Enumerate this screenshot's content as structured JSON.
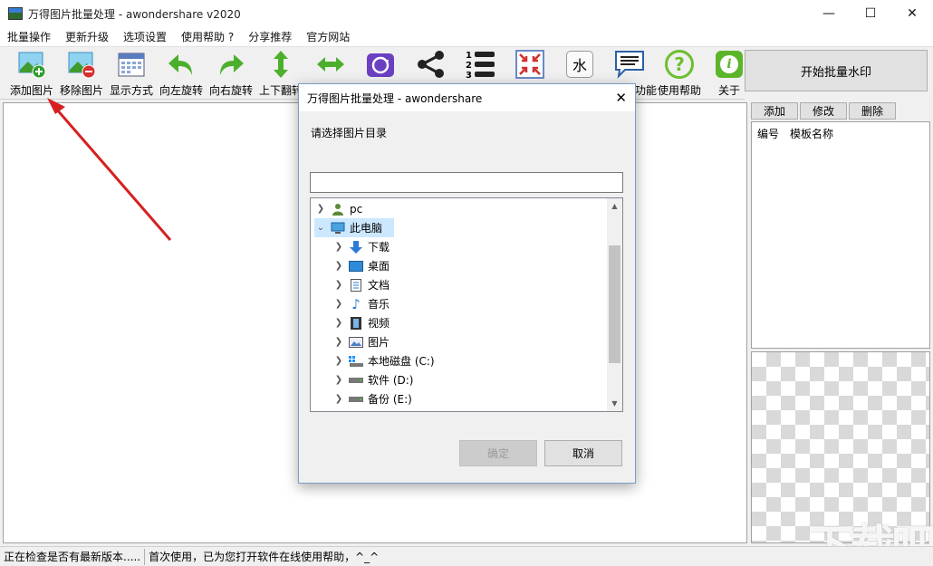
{
  "window": {
    "title": "万得图片批量处理 - awondershare v2020",
    "minimize": "—",
    "maximize": "☐",
    "close": "✕"
  },
  "menu": [
    "批量操作",
    "更新升级",
    "选项设置",
    "使用帮助 ?",
    "分享推荐",
    "官方网站"
  ],
  "toolbar": [
    {
      "label": "添加图片",
      "icon": "add-image-icon"
    },
    {
      "label": "移除图片",
      "icon": "remove-image-icon"
    },
    {
      "label": "显示方式",
      "icon": "display-mode-icon"
    },
    {
      "label": "向左旋转",
      "icon": "rotate-left-icon"
    },
    {
      "label": "向右旋转",
      "icon": "rotate-right-icon"
    },
    {
      "label": "上下翻转",
      "icon": "flip-vertical-icon"
    },
    {
      "label": "",
      "icon": "flip-horizontal-icon"
    },
    {
      "label": "",
      "icon": "camera-rotate-icon"
    },
    {
      "label": "",
      "icon": "share-icon"
    },
    {
      "label": "",
      "icon": "numbered-list-icon"
    },
    {
      "label": "",
      "icon": "resize-icon"
    },
    {
      "label": "",
      "icon": "watermark-icon",
      "glyph": "水"
    },
    {
      "label": "功能",
      "icon": "message-icon"
    },
    {
      "label": "使用帮助",
      "icon": "help-icon",
      "glyph": "?"
    },
    {
      "label": "关于",
      "icon": "info-icon",
      "glyph": "i"
    }
  ],
  "start_button": "开始批量水印",
  "template_panel": {
    "buttons": [
      "添加",
      "修改",
      "删除"
    ],
    "columns": [
      "编号",
      "模板名称"
    ]
  },
  "status": {
    "left": "正在检查是否有最新版本.....",
    "right": "首次使用，已为您打开软件在线使用帮助，^_^"
  },
  "dialog": {
    "title": "万得图片批量处理 - awondershare",
    "close": "✕",
    "prompt": "请选择图片目录",
    "input_value": "",
    "tree": [
      {
        "label": "pc",
        "level": 0,
        "expanded": false,
        "icon": "user-icon",
        "selected": false
      },
      {
        "label": "此电脑",
        "level": 0,
        "expanded": true,
        "icon": "computer-icon",
        "selected": true
      },
      {
        "label": "下载",
        "level": 1,
        "expanded": false,
        "icon": "download-icon",
        "selected": false
      },
      {
        "label": "桌面",
        "level": 1,
        "expanded": false,
        "icon": "desktop-icon",
        "selected": false
      },
      {
        "label": "文档",
        "level": 1,
        "expanded": false,
        "icon": "document-icon",
        "selected": false
      },
      {
        "label": "音乐",
        "level": 1,
        "expanded": false,
        "icon": "music-icon",
        "selected": false
      },
      {
        "label": "视频",
        "level": 1,
        "expanded": false,
        "icon": "video-icon",
        "selected": false
      },
      {
        "label": "图片",
        "level": 1,
        "expanded": false,
        "icon": "picture-icon",
        "selected": false
      },
      {
        "label": "本地磁盘 (C:)",
        "level": 1,
        "expanded": false,
        "icon": "system-drive-icon",
        "selected": false
      },
      {
        "label": "软件 (D:)",
        "level": 1,
        "expanded": false,
        "icon": "drive-icon",
        "selected": false
      },
      {
        "label": "备份 (E:)",
        "level": 1,
        "expanded": false,
        "icon": "drive-icon",
        "selected": false
      }
    ],
    "ok": "确定",
    "cancel": "取消"
  },
  "watermark_text": "下载吧",
  "colors": {
    "accent_green": "#4caf2c",
    "arrow_red": "#d62020",
    "selection": "#cce8ff",
    "camera_purple": "#6a3fc1"
  }
}
